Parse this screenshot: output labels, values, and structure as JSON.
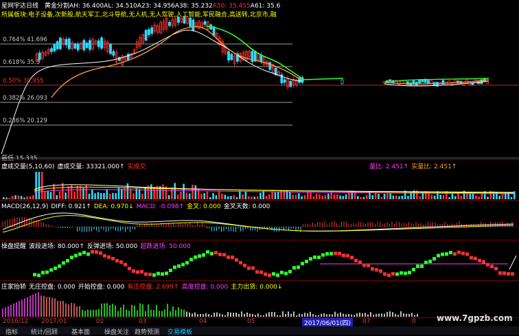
{
  "colors": {
    "background": "#000000",
    "up_candle": "#ff3030",
    "down_candle": "#30d8ff",
    "ma_white": "#ffffff",
    "ma_orange": "#ff9a30",
    "ma_green": "#30ff30",
    "separator": "#7a0000",
    "yellow": "#ffff00",
    "magenta": "#ff40ff"
  },
  "main": {
    "title": "星网宇达日线",
    "legend": [
      {
        "text": "黄金分割",
        "color": "#ffffff"
      },
      {
        "text": "AH: 36.400",
        "color": "#ffffff"
      },
      {
        "text": "AL: 34.510",
        "color": "#ffffff"
      },
      {
        "text": "A23: 34.956",
        "color": "#ffffff"
      },
      {
        "text": "A38: 35.232",
        "color": "#ffffff"
      },
      {
        "text": "A50: 35.455",
        "color": "#ff3030"
      },
      {
        "text": "A61: 35.6",
        "color": "#ffffff"
      }
    ],
    "sectors": "所属板块:电子设备,次新股,航天军工,北斗导航,无人机,无人驾驶,人工智能,军民融合,高送转,北京市,融",
    "fib_levels": [
      {
        "label": "0.764% 41.696",
        "red": false
      },
      {
        "label": "0.618% 35.3",
        "red": false
      },
      {
        "label": "0.50% 30.955",
        "red": true
      },
      {
        "label": "0.382% 26.093",
        "red": false
      },
      {
        "label": "0.236% 20.129",
        "red": false
      }
    ],
    "bottom_label": "最低 15.335"
  },
  "volume": {
    "legend": [
      {
        "text": "虚成交量(5,10,60)",
        "color": "#ffffff"
      },
      {
        "text": "虚成交量: 33321.000↑",
        "color": "#ffffff"
      },
      {
        "text": "实成交",
        "color": "#ff3030"
      }
    ],
    "right_legend": [
      {
        "text": "量比: 2.451↑",
        "color": "#ff40ff"
      },
      {
        "text": "实量比: 2.451↑",
        "color": "#ff9a30"
      }
    ]
  },
  "macd": {
    "legend": [
      {
        "text": "MACD(26,12,9)",
        "color": "#ffffff"
      },
      {
        "text": "DIFF: 0.921↑",
        "color": "#ffffff"
      },
      {
        "text": "DEA: 0.970↓",
        "color": "#ffff00"
      },
      {
        "text": "MACD: -0.098↑",
        "color": "#ff40ff"
      },
      {
        "text": "金叉: 0.000",
        "color": "#ffff00"
      },
      {
        "text": "金叉天数: 0.000",
        "color": "#ffffff"
      }
    ]
  },
  "op": {
    "legend": [
      {
        "text": "操盘提醒",
        "color": "#ffffff"
      },
      {
        "text": "波段进场: 80.000↑",
        "color": "#ffffff"
      },
      {
        "text": "反弹进场: 50.000",
        "color": "#ffffff"
      },
      {
        "text": "超跌进场: 50.000",
        "color": "#ff40ff"
      }
    ]
  },
  "zhuang": {
    "legend": [
      {
        "text": "庄家抬轿",
        "color": "#ffffff"
      },
      {
        "text": "无庄控盘: 0.000",
        "color": "#ffffff"
      },
      {
        "text": "开始控盘: 0.000",
        "color": "#ffffff"
      },
      {
        "text": "有庄控盘: 2.699↑",
        "color": "#ff3030"
      },
      {
        "text": "高度控盘: 0.000",
        "color": "#ff40ff"
      },
      {
        "text": "主力出货: 0.000↓",
        "color": "#ffff00"
      }
    ]
  },
  "xaxis": {
    "labels": [
      {
        "text": "2016/12",
        "highlight": false
      },
      {
        "text": "2017/01",
        "highlight": false
      },
      {
        "text": "02",
        "highlight": false
      },
      {
        "text": "03",
        "highlight": false
      },
      {
        "text": "04",
        "highlight": false
      },
      {
        "text": "05",
        "highlight": false
      },
      {
        "text": "2017/06/01(四)",
        "highlight": true
      },
      {
        "text": "07",
        "highlight": false
      },
      {
        "text": "0",
        "highlight": false
      }
    ]
  },
  "tabs": [
    "指标",
    "统计/回顾",
    "基本面",
    "操盘关注",
    "趋势预测",
    "交易模板"
  ],
  "watermark": "www.7gpzb.com"
}
